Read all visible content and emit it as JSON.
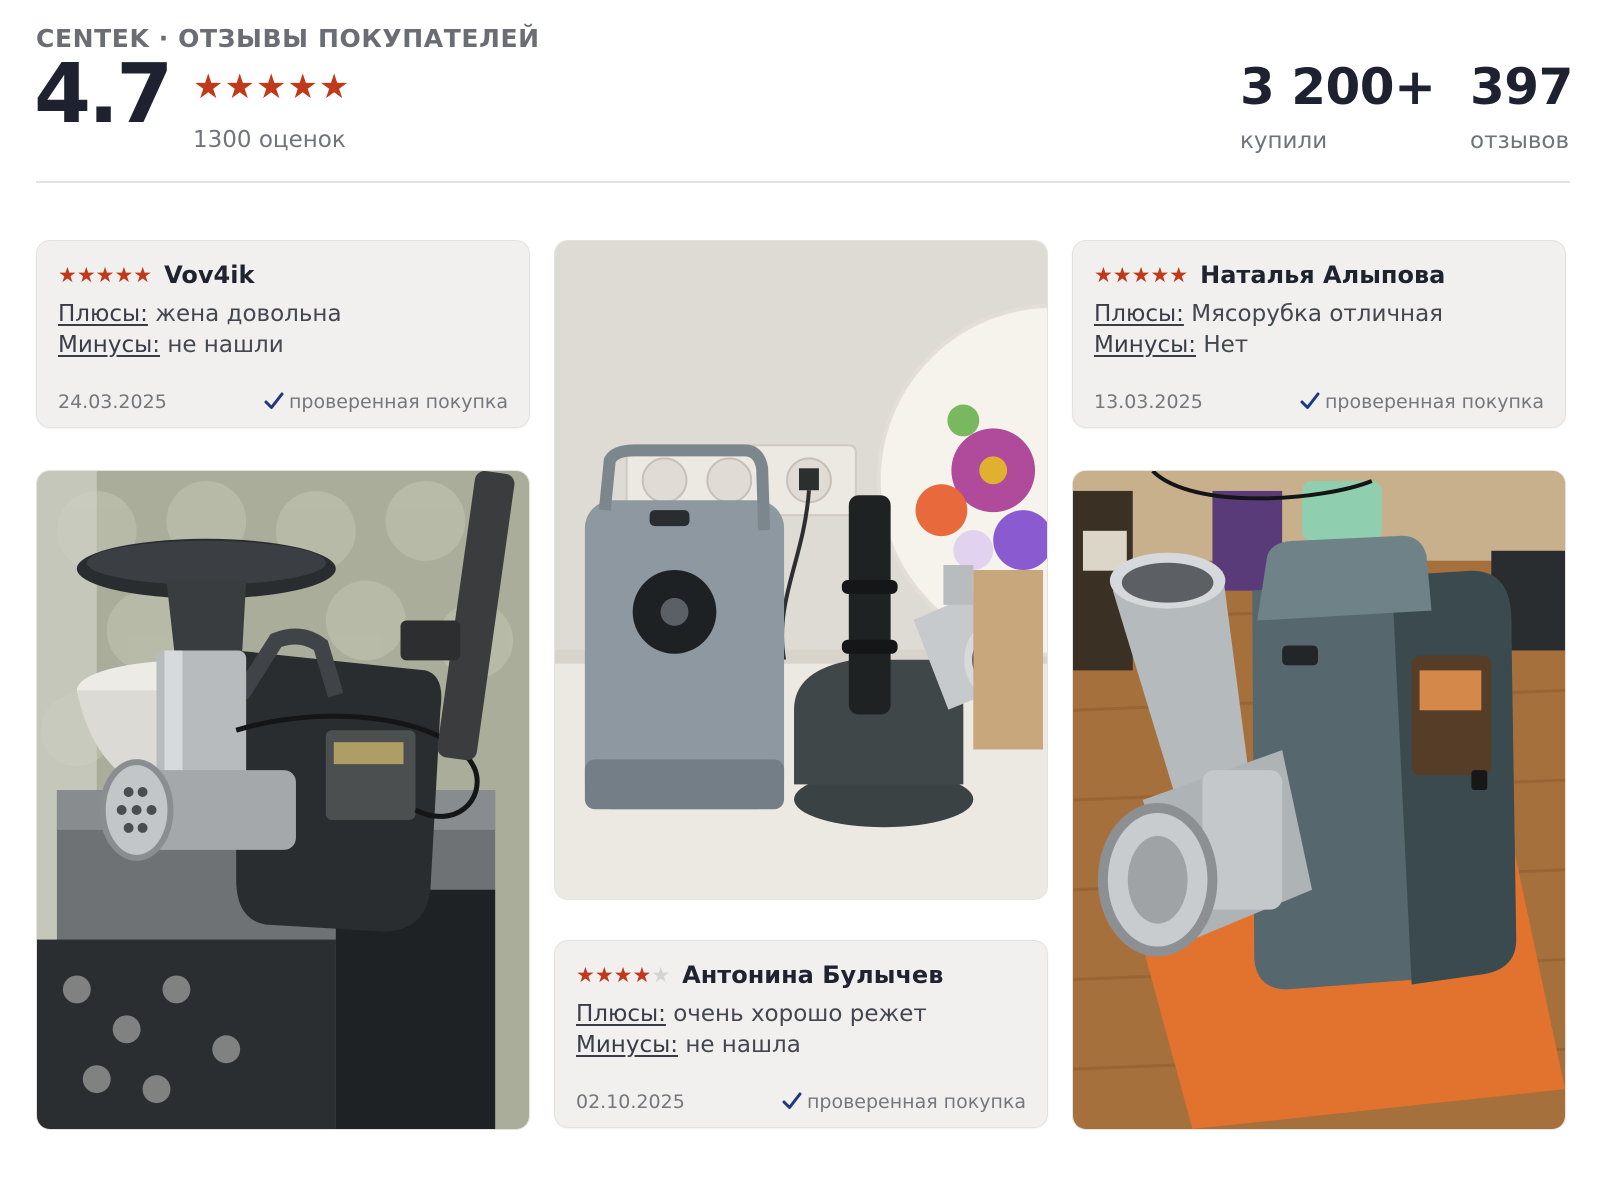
{
  "header": {
    "brand": "CENTEK · ОТЗЫВЫ ПОКУПАТЕЛЕЙ",
    "rating": "4.7",
    "stars": "★★★★★",
    "ratings_count": "1300 оценок",
    "stats": [
      {
        "value": "3 200+",
        "label": "купили"
      },
      {
        "value": "397",
        "label": "отзывов"
      }
    ]
  },
  "reviews": [
    {
      "stars": "★★★★★",
      "author": "Vov4ik",
      "pros_label": "Плюсы:",
      "pros": "жена довольна",
      "cons_label": "Минусы:",
      "cons": "не нашли",
      "date": "24.03.2025",
      "verified": "проверенная покупка"
    },
    {
      "stars": "★★★★★",
      "author": "Наталья Алыпова",
      "pros_label": "Плюсы:",
      "pros": "Мясорубка отличная",
      "cons_label": "Минусы:",
      "cons": "Нет",
      "date": "13.03.2025",
      "verified": "проверенная покупка"
    },
    {
      "stars_on": "★★★★",
      "stars_off": "★",
      "author": "Антонина Булычев",
      "pros_label": "Плюсы:",
      "pros": "очень хорошо режет",
      "cons_label": "Минусы:",
      "cons": "не нашла",
      "date": "02.10.2025",
      "verified": "проверенная покупка"
    }
  ],
  "colors": {
    "star": "#c0391a",
    "check": "#1d3a7a",
    "card_bg": "#f1f0ee"
  }
}
